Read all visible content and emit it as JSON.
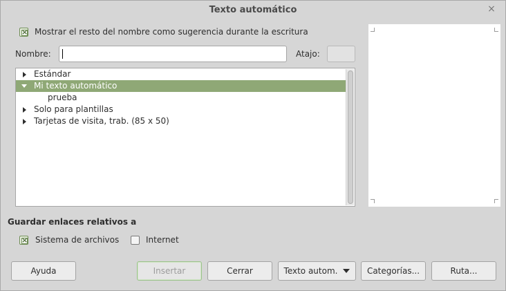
{
  "window": {
    "title": "Texto automático",
    "close_glyph": "×"
  },
  "suggest_checkbox": {
    "label": "Mostrar el resto del nombre como sugerencia durante la escritura",
    "checked": true
  },
  "name_field": {
    "label": "Nombre:",
    "value": ""
  },
  "shortcut_field": {
    "label": "Atajo:",
    "value": ""
  },
  "tree": {
    "items": [
      {
        "label": "Estándar",
        "expanded": false,
        "selected": false,
        "level": 0
      },
      {
        "label": "Mi texto automático",
        "expanded": true,
        "selected": true,
        "level": 0
      },
      {
        "label": "prueba",
        "expanded": false,
        "selected": false,
        "level": 1
      },
      {
        "label": "Solo para plantillas",
        "expanded": false,
        "selected": false,
        "level": 0
      },
      {
        "label": "Tarjetas de visita, trab. (85 x 50)",
        "expanded": false,
        "selected": false,
        "level": 0
      }
    ]
  },
  "links_section": {
    "heading": "Guardar enlaces relativos a",
    "filesystem": {
      "label": "Sistema de archivos",
      "checked": true
    },
    "internet": {
      "label": "Internet",
      "checked": false
    }
  },
  "buttons": {
    "help": "Ayuda",
    "insert": "Insertar",
    "close": "Cerrar",
    "autotext": "Texto autom.",
    "categories": "Categorías...",
    "path": "Ruta..."
  },
  "colors": {
    "selection": "#8fa876",
    "check_accent": "#6f8d55",
    "background": "#d6d6d6"
  }
}
